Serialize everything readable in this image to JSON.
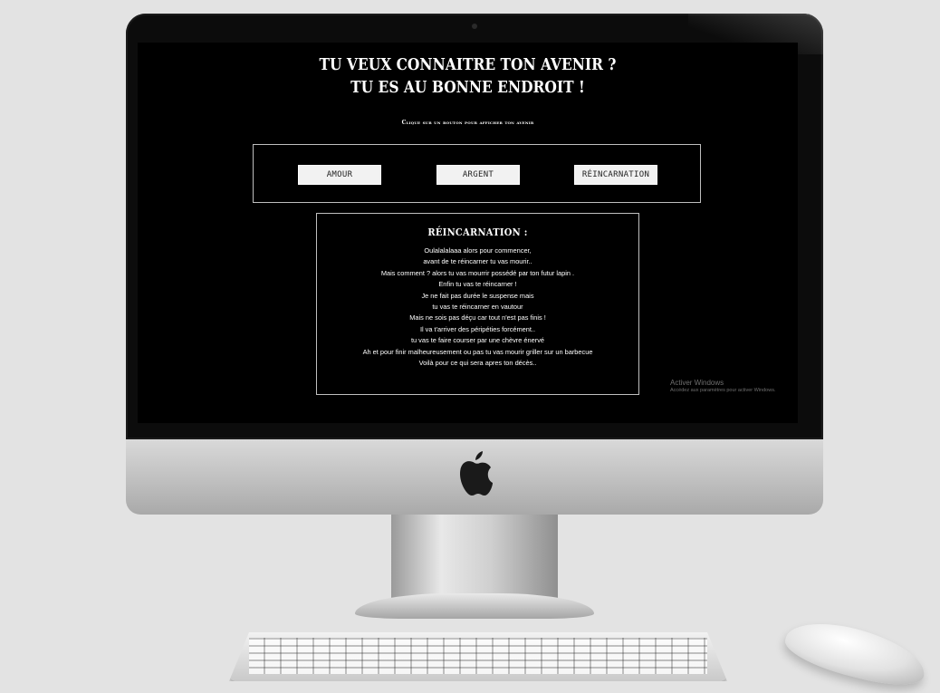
{
  "page": {
    "title_line1": "TU VEUX CONNAITRE TON AVENIR ?",
    "title_line2": "TU ES AU BONNE ENDROIT !",
    "subtitle": "Clique sur un bouton pour afficher ton avenir"
  },
  "buttons": [
    {
      "label": "AMOUR"
    },
    {
      "label": "ARGENT"
    },
    {
      "label": "RÉINCARNATION"
    }
  ],
  "result": {
    "title": "RÉINCARNATION :",
    "lines": [
      "Oulalalalaaa alors pour commencer,",
      "avant de te réincarner tu vas mourir..",
      "Mais comment ? alors tu vas mourrir possédé par ton futur lapin .",
      "Enfin tu vas te réincarner !",
      "Je ne fait pas durée le suspense mais",
      "tu vas te réincarner en vautour",
      "Mais ne sois pas déçu car tout n'est pas finis !",
      "Il va t'arriver des péripéties forcément..",
      "tu vas te faire courser par une chèvre énervé",
      "Ah et pour finir malheureusement ou pas tu vas mourir griller sur un barbecue",
      "Voilà pour ce qui sera apres ton décès.."
    ]
  },
  "watermark": {
    "line1": "Activer Windows",
    "line2": "Accédez aux paramètres pour activer Windows."
  },
  "colors": {
    "screen_bg": "#000000",
    "text": "#ffffff",
    "button_bg": "#f2f2f2",
    "border": "#bfbfbf"
  }
}
